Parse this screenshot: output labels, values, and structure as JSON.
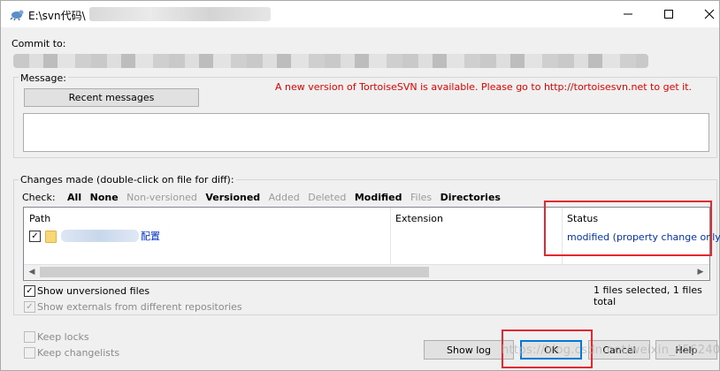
{
  "window": {
    "title": "E:\\svn代码\\",
    "icon": "tortoise-svn-icon",
    "controls": {
      "minimize": "minimize-icon",
      "maximize": "maximize-icon",
      "close": "close-icon"
    }
  },
  "commit_to_label": "Commit to:",
  "message_section": {
    "label": "Message:",
    "recent_button": "Recent messages",
    "notice": "A new version of TortoiseSVN is available. Please go to http://tortoisesvn.net to get it.",
    "notice_color": "#e00000",
    "message_value": ""
  },
  "changes": {
    "label": "Changes made (double-click on file for diff):",
    "check_label": "Check:",
    "filters": [
      {
        "label": "All",
        "enabled": true
      },
      {
        "label": "None",
        "enabled": true
      },
      {
        "label": "Non-versioned",
        "enabled": false
      },
      {
        "label": "Versioned",
        "enabled": true
      },
      {
        "label": "Added",
        "enabled": false
      },
      {
        "label": "Deleted",
        "enabled": false
      },
      {
        "label": "Modified",
        "enabled": true
      },
      {
        "label": "Files",
        "enabled": false
      },
      {
        "label": "Directories",
        "enabled": true
      }
    ],
    "columns": {
      "path": "Path",
      "extension": "Extension",
      "status": "Status"
    },
    "rows": [
      {
        "checked": true,
        "name_visible": "配置",
        "extension": "",
        "status": "modified (property change only)"
      }
    ],
    "selection_summary": "1 files selected, 1 files total"
  },
  "options": {
    "show_unversioned": {
      "label": "Show unversioned files",
      "checked": true
    },
    "show_externals": {
      "label": "Show externals from different repositories",
      "checked": true,
      "enabled": false
    },
    "keep_locks": {
      "label": "Keep locks",
      "checked": false,
      "enabled": false
    },
    "keep_changelists": {
      "label": "Keep changelists",
      "checked": false,
      "enabled": false
    }
  },
  "buttons": {
    "show_log": "Show log",
    "ok": "OK",
    "cancel": "Cancel",
    "help": "Help"
  },
  "watermark": "https://blog.csdn.net/weixin_45624070",
  "highlight_color": "#e4282e"
}
